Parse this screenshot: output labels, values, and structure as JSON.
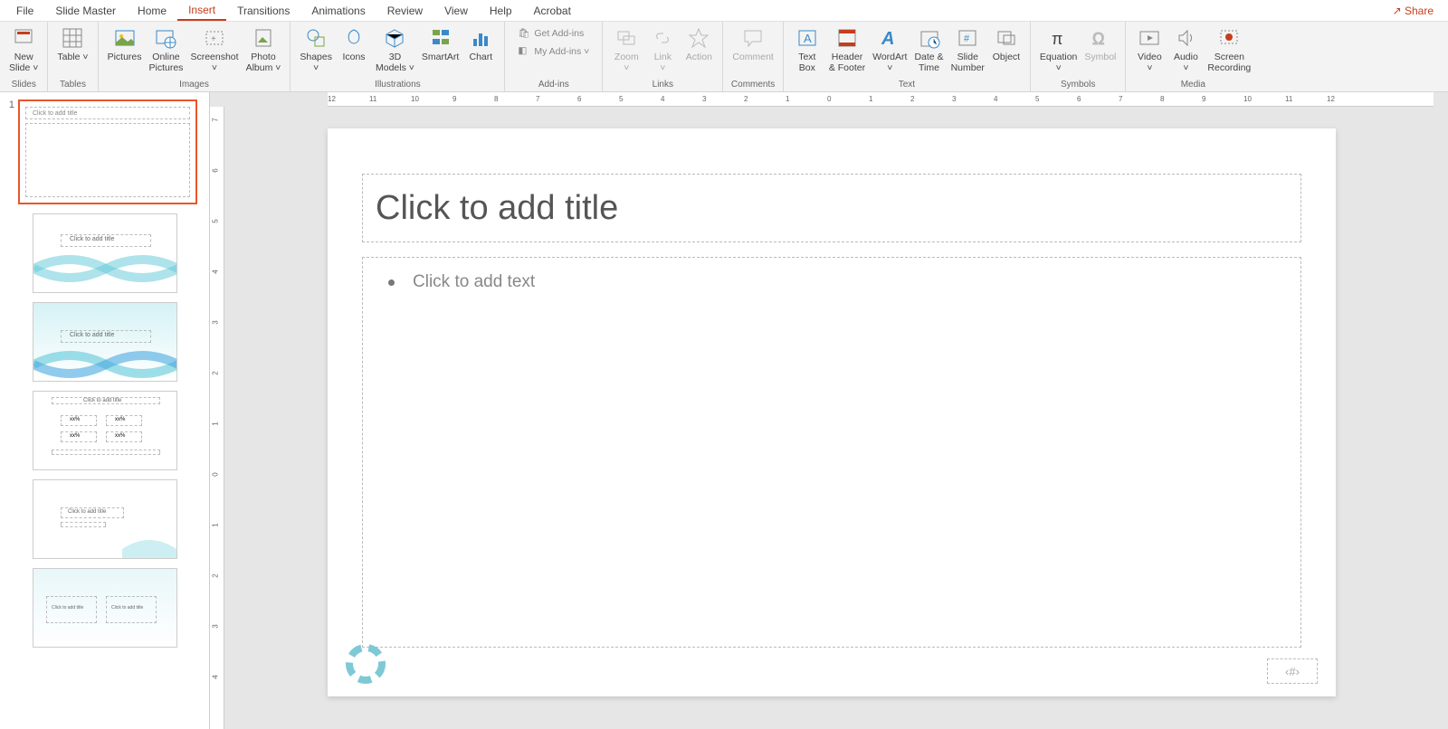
{
  "menu": {
    "file": "File",
    "slidemaster": "Slide Master",
    "home": "Home",
    "insert": "Insert",
    "transitions": "Transitions",
    "animations": "Animations",
    "review": "Review",
    "view": "View",
    "help": "Help",
    "acrobat": "Acrobat",
    "share": "Share"
  },
  "ribbon": {
    "slides": {
      "label": "Slides",
      "newslide": "New\nSlide ˅"
    },
    "tables": {
      "label": "Tables",
      "table": "Table ˅"
    },
    "images": {
      "label": "Images",
      "pictures": "Pictures",
      "online": "Online\nPictures",
      "screenshot": "Screenshot\n˅",
      "album": "Photo\nAlbum ˅"
    },
    "illustrations": {
      "label": "Illustrations",
      "shapes": "Shapes\n˅",
      "icons": "Icons",
      "models": "3D\nModels ˅",
      "smartart": "SmartArt",
      "chart": "Chart"
    },
    "addins": {
      "label": "Add-ins",
      "get": "Get Add-ins",
      "my": "My Add-ins  ˅"
    },
    "links": {
      "label": "Links",
      "zoom": "Zoom\n˅",
      "link": "Link\n˅",
      "action": "Action"
    },
    "comments": {
      "label": "Comments",
      "comment": "Comment"
    },
    "text": {
      "label": "Text",
      "textbox": "Text\nBox",
      "header": "Header\n& Footer",
      "wordart": "WordArt\n˅",
      "datetime": "Date &\nTime",
      "slidenum": "Slide\nNumber",
      "object": "Object"
    },
    "symbols": {
      "label": "Symbols",
      "equation": "Equation\n˅",
      "symbol": "Symbol"
    },
    "media": {
      "label": "Media",
      "video": "Video\n˅",
      "audio": "Audio\n˅",
      "recording": "Screen\nRecording"
    }
  },
  "slide": {
    "title_ph": "Click to add title",
    "body_ph": "Click to add text",
    "pagenum": "‹#›"
  },
  "thumbs": {
    "num1": "1",
    "t1": "Click to add title",
    "t2": "Click to add title",
    "t3": "Click to add title",
    "t4": "Click to add title",
    "t5": "Click to add title",
    "t6a": "Click to add title",
    "t6b": "Click to add title",
    "xx": "xx%"
  },
  "ruler": [
    "12",
    "11",
    "10",
    "9",
    "8",
    "7",
    "6",
    "5",
    "4",
    "3",
    "2",
    "1",
    "0",
    "1",
    "2",
    "3",
    "4",
    "5",
    "6",
    "7",
    "8",
    "9",
    "10",
    "11",
    "12"
  ],
  "vruler": [
    "7",
    "6",
    "5",
    "4",
    "3",
    "2",
    "1",
    "0",
    "1",
    "2",
    "3",
    "4"
  ]
}
